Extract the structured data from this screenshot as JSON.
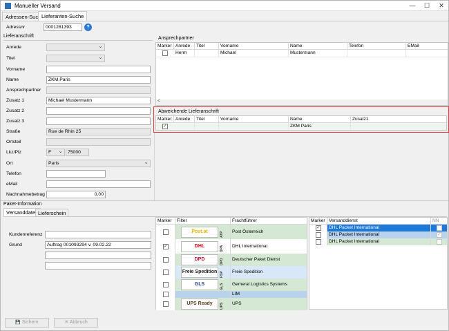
{
  "window": {
    "title": "Manueller Versand",
    "minimize_glyph": "—",
    "maximize_glyph": "☐",
    "close_glyph": "✕"
  },
  "top_tabs": [
    {
      "label": "Adressen-Suche"
    },
    {
      "label": "Lieferanten-Suche"
    }
  ],
  "adressnr": {
    "label": "Adressnr",
    "value": "0001281393",
    "help_glyph": "?"
  },
  "lieferanschrift": {
    "title": "Lieferanschrift",
    "fields": [
      {
        "label": "Anrede",
        "value": ""
      },
      {
        "label": "Titel",
        "value": ""
      },
      {
        "label": "Vorname",
        "value": ""
      },
      {
        "label": "Name",
        "value": "ZKM Paris"
      },
      {
        "label": "Ansprechpartner",
        "value": ""
      },
      {
        "label": "Zusatz 1",
        "value": "Michael Mustermann"
      },
      {
        "label": "Zusatz 2",
        "value": ""
      },
      {
        "label": "Zusatz 3",
        "value": ""
      },
      {
        "label": "Straße",
        "value": "Rue de Rhin 25"
      },
      {
        "label": "Ortsteil",
        "value": ""
      },
      {
        "label": "Lkz/Plz",
        "lkz": "F",
        "plz": "75000"
      },
      {
        "label": "Ort",
        "value": "Paris"
      },
      {
        "label": "Telefon",
        "value": ""
      },
      {
        "label": "eMail",
        "value": ""
      },
      {
        "label": "Nachnahmebetrag",
        "value": "0,00"
      }
    ]
  },
  "ansprechpartner": {
    "title": "Ansprechpartner",
    "columns": [
      "Marker",
      "Anrede",
      "Titel",
      "Vorname",
      "Name",
      "Telefon",
      "EMail"
    ],
    "rows": [
      {
        "checked": false,
        "anrede": "Herrn",
        "titel": "",
        "vorname": "Michael",
        "name": "Mustermann",
        "telefon": "",
        "email": ""
      }
    ],
    "scroll_glyph": "<"
  },
  "abweichende": {
    "title": "Abweichende Lieferanschrift",
    "columns": [
      "Marker",
      "Anrede",
      "Titel",
      "Vorname",
      "Name",
      "Zusatz1"
    ],
    "rows": [
      {
        "checked": true,
        "anrede": "",
        "titel": "",
        "vorname": "",
        "name": "ZKM Paris",
        "zusatz1": ""
      }
    ]
  },
  "paket": {
    "title": "Paket-Information",
    "tabs": [
      {
        "label": "Versanddaten"
      },
      {
        "label": "Lieferschein"
      }
    ],
    "kundenreferenz": {
      "label": "Kundenreferenz",
      "value": ""
    },
    "grund": {
      "label": "Grund",
      "value": "Auftrag 001093294 v. 09.02.22",
      "extra1": "",
      "extra2": ""
    }
  },
  "carriers": {
    "columns": [
      "Marker",
      "Filter",
      "Frachtführer"
    ],
    "rows": [
      {
        "checked": false,
        "logo": "Post.at",
        "code": "ATP",
        "name": "Post Österreich",
        "color": "#d4e8d4",
        "logo_color": "#e8b800"
      },
      {
        "checked": true,
        "logo": "DHL",
        "code": "DPA",
        "name": "DHL International",
        "color": "#ffffff",
        "logo_color": "#d40511"
      },
      {
        "checked": false,
        "logo": "DPD",
        "code": "DPD",
        "name": "Deutscher Paket Dienst",
        "color": "#d4e8d4",
        "logo_color": "#c8102e"
      },
      {
        "checked": false,
        "logo": "Freie Spedition",
        "code": "FSP",
        "name": "Freie Spedition",
        "color": "#d8e8f8",
        "logo_color": "#222222"
      },
      {
        "checked": false,
        "logo": "GLS",
        "code": "GLS",
        "name": "Gemeral Logistics Systems",
        "color": "#d4e8d4",
        "logo_color": "#1a3c8c"
      },
      {
        "checked": false,
        "logo": "",
        "code": "",
        "name": "LIM",
        "color": "#b9d3ef",
        "logo_color": "#ffffff"
      },
      {
        "checked": false,
        "logo": "UPS Ready",
        "code": "UPS",
        "name": "UPS",
        "color": "#d4e8d4",
        "logo_color": "#5a3b1c"
      }
    ]
  },
  "versanddienst": {
    "columns": [
      "Marker",
      "Versanddienst",
      "NN"
    ],
    "rows": [
      {
        "checked": true,
        "name": "DHL Packet International",
        "nn": false,
        "color": "#1e78d8",
        "text_color": "#ffffff"
      },
      {
        "checked": false,
        "name": "DHL Packet International",
        "nn": true,
        "color": "#b9d3ef",
        "text_color": "#000000"
      },
      {
        "checked": false,
        "name": "DHL Packet International",
        "nn": false,
        "color": "#d4e8d4",
        "text_color": "#000000"
      }
    ]
  },
  "buttons": {
    "save": "Sichern",
    "cancel": "Abbruch",
    "save_glyph": "💾",
    "cancel_glyph": "✕"
  }
}
